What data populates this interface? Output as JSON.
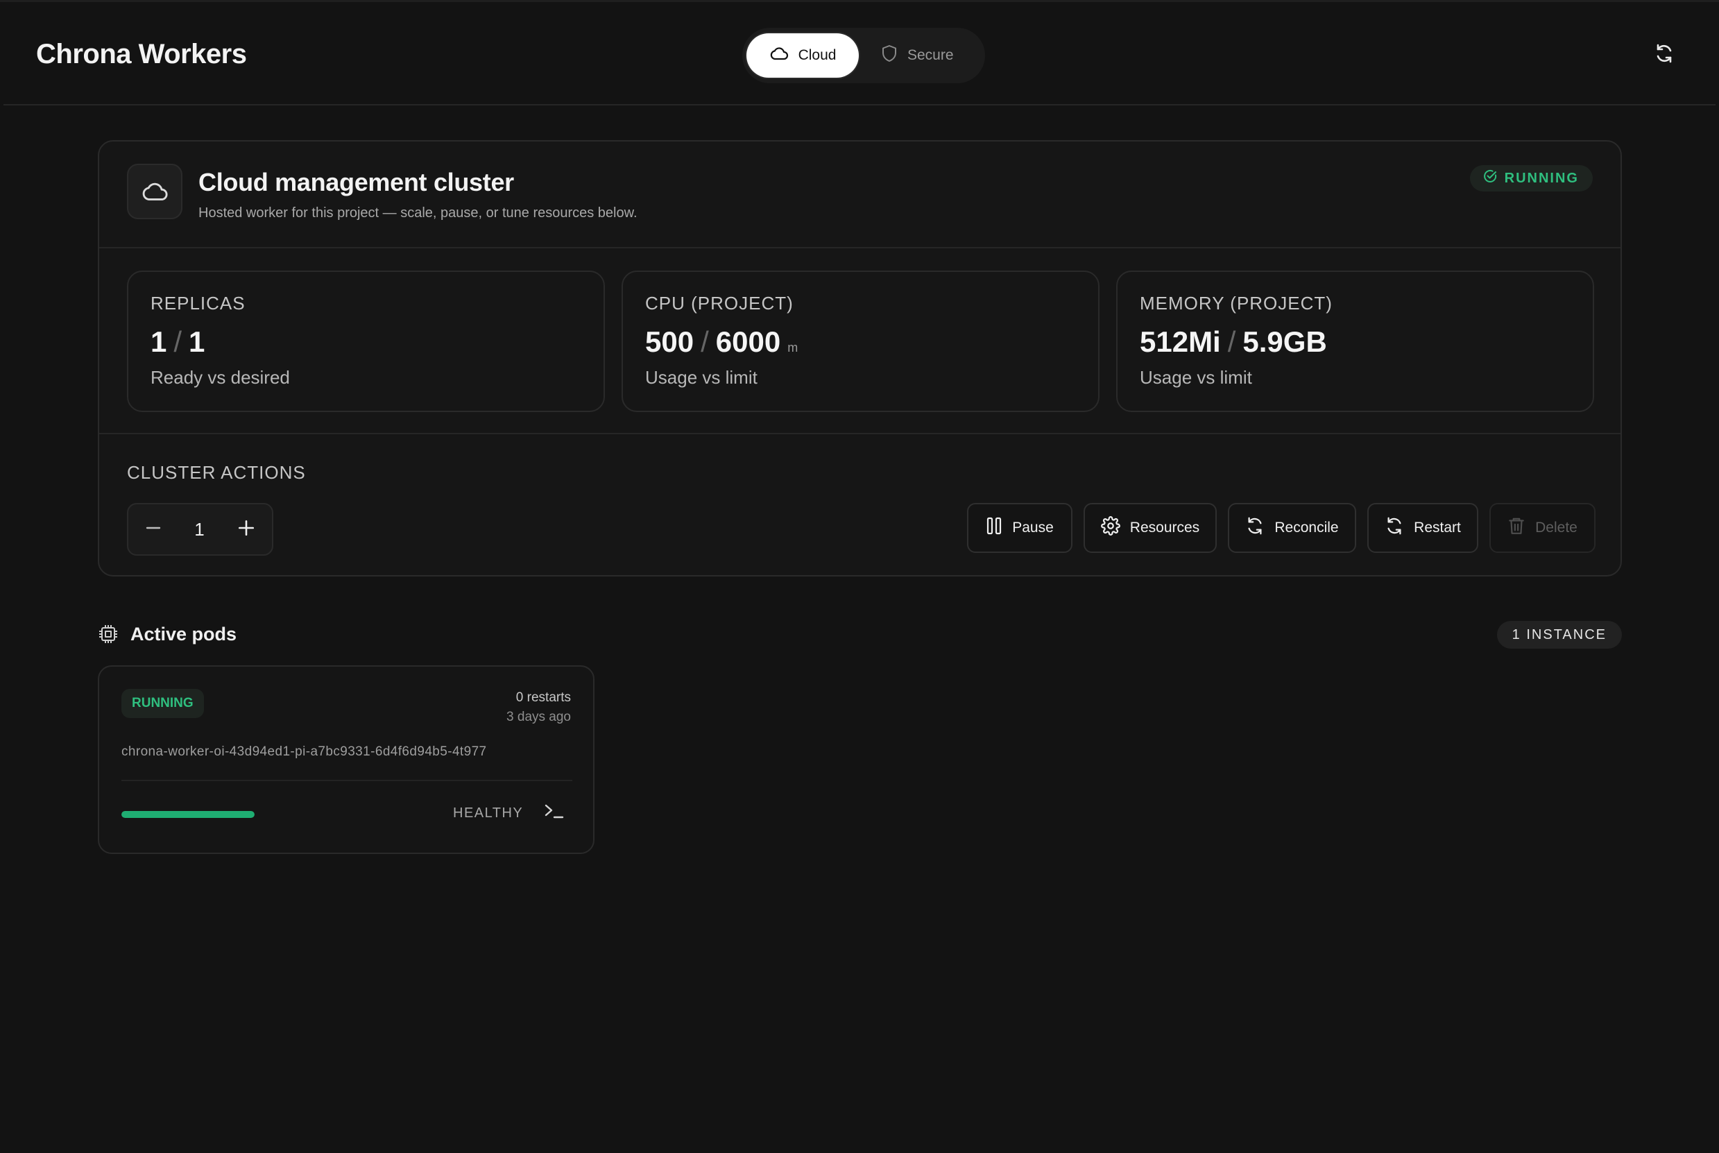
{
  "header": {
    "app_title": "Chrona Workers",
    "modes": [
      {
        "label": "Cloud",
        "icon": "cloud-icon",
        "selected": true
      },
      {
        "label": "Secure",
        "icon": "shield-icon",
        "selected": false
      }
    ],
    "refresh_icon": "refresh-icon"
  },
  "cluster": {
    "icon": "cloud-icon",
    "title": "Cloud management cluster",
    "subtitle": "Hosted worker for this project — scale, pause, or tune resources below.",
    "status": "RUNNING",
    "status_color": "#2fbf7f",
    "stats": [
      {
        "label": "REPLICAS",
        "current": "1",
        "separator": "/",
        "limit": "1",
        "unit": "",
        "description": "Ready vs desired"
      },
      {
        "label": "CPU (PROJECT)",
        "current": "500",
        "separator": "/",
        "limit": "6000",
        "unit": "m",
        "description": "Usage vs limit"
      },
      {
        "label": "MEMORY (PROJECT)",
        "current": "512Mi",
        "separator": "/",
        "limit": "5.9GB",
        "unit": "",
        "description": "Usage vs limit"
      }
    ],
    "actions_label": "CLUSTER ACTIONS",
    "replica_count": "1",
    "actions": [
      {
        "label": "Pause",
        "icon": "pause-icon",
        "disabled": false
      },
      {
        "label": "Resources",
        "icon": "gear-icon",
        "disabled": false
      },
      {
        "label": "Reconcile",
        "icon": "refresh-icon",
        "disabled": false
      },
      {
        "label": "Restart",
        "icon": "refresh-icon",
        "disabled": false
      },
      {
        "label": "Delete",
        "icon": "trash-icon",
        "disabled": true
      }
    ]
  },
  "pods": {
    "icon": "cpu-chip-icon",
    "title": "Active pods",
    "instance_count": "1 INSTANCE",
    "items": [
      {
        "state": "RUNNING",
        "restarts": "0 restarts",
        "age": "3 days ago",
        "name": "chrona-worker-oi-43d94ed1-pi-a7bc9331-6d4f6d94b5-4t977",
        "health_label": "HEALTHY",
        "health_fraction": 1.0,
        "health_color": "#1fae72",
        "terminal_icon": "terminal-icon"
      }
    ]
  }
}
